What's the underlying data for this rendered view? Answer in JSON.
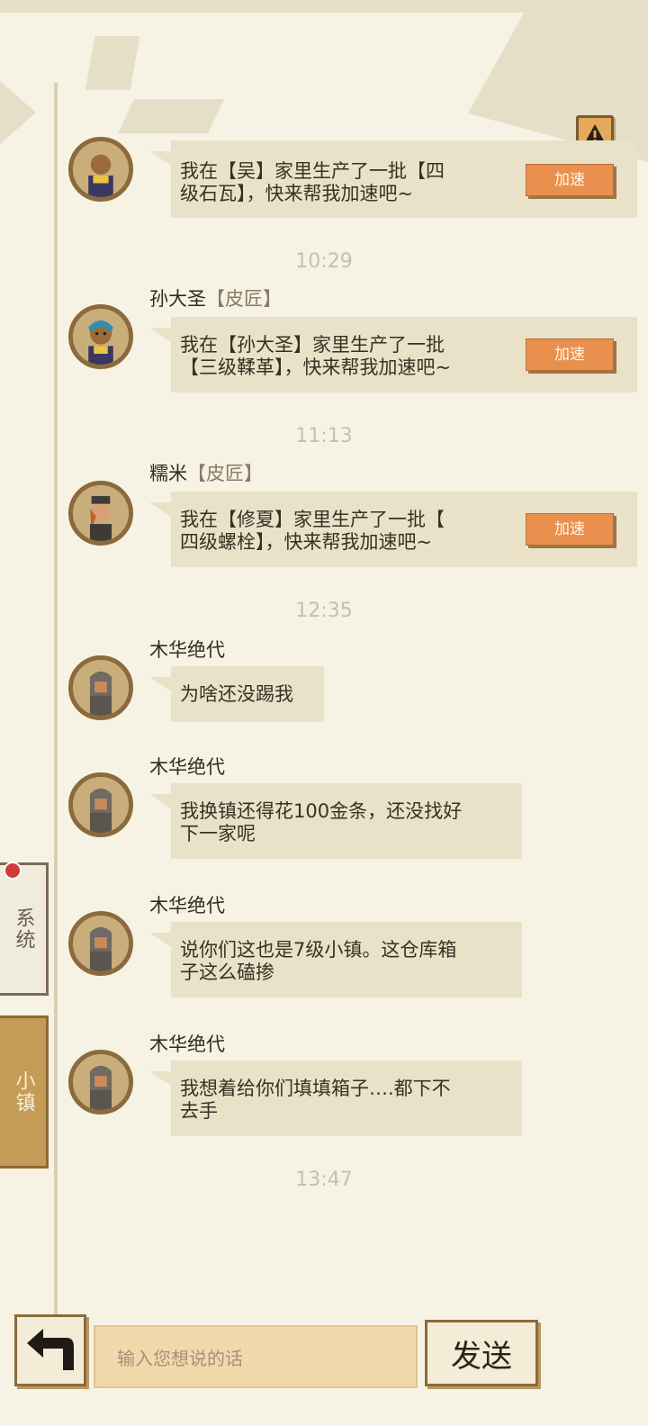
{
  "colors": {
    "background": "#f6f3e4",
    "bubble": "#e9e2c8",
    "speed_button": "#e9904f",
    "town_tab": "#c49c58",
    "input": "#f1d9ac"
  },
  "header": {
    "warning_icon": "warning-icon"
  },
  "messages": [
    {
      "sender_name": "",
      "sender_role": "",
      "text": "我在【吴】家里生产了一批【四\n级石瓦】，快来帮我加速吧~",
      "button": "加速"
    },
    {
      "time": "10:29"
    },
    {
      "sender_name": "孙大圣",
      "sender_role": "【皮匠】",
      "text": "我在【孙大圣】家里生产了一批\n【三级鞣革】，快来帮我加速吧~",
      "button": "加速"
    },
    {
      "time": "11:13"
    },
    {
      "sender_name": "糯米",
      "sender_role": "【皮匠】",
      "text": "我在【修夏】家里生产了一批【\n四级螺栓】，快来帮我加速吧~",
      "button": "加速"
    },
    {
      "time": "12:35"
    },
    {
      "sender_name": "木华绝代",
      "text": "为啥还没踢我"
    },
    {
      "sender_name": "木华绝代",
      "text": "我换镇还得花100金条，还没找好\n下一家呢"
    },
    {
      "sender_name": "木华绝代",
      "text": "说你们这也是7级小镇。这仓库箱\n子这么磕掺"
    },
    {
      "sender_name": "木华绝代",
      "text": "我想着给你们填填箱子….都下不\n去手"
    },
    {
      "time": "13:47"
    }
  ],
  "side_tabs": {
    "system": "系统",
    "town": "小镇"
  },
  "input": {
    "placeholder": "输入您想说的话"
  },
  "send_label": "发送"
}
